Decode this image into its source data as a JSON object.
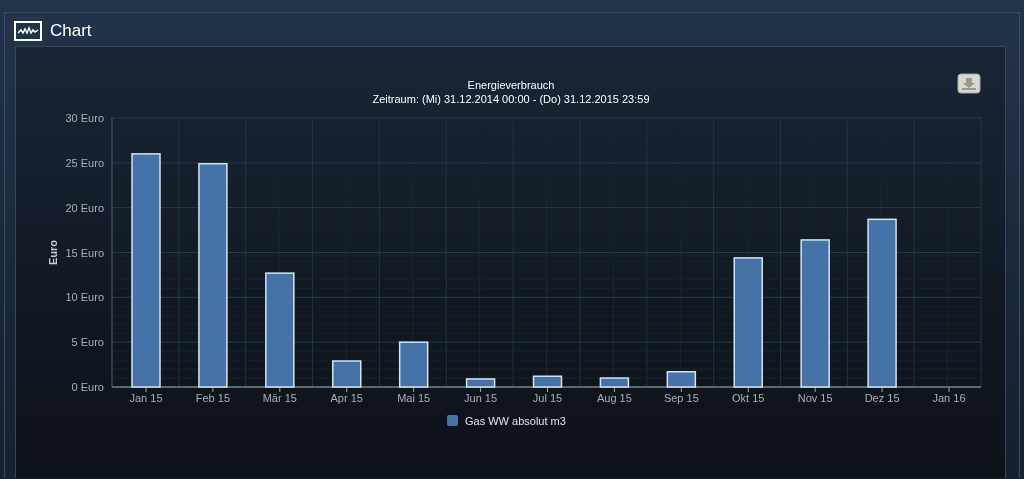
{
  "panel": {
    "title": "Chart"
  },
  "chart_data": {
    "type": "bar",
    "title": "Energieverbrauch",
    "subtitle": "Zeitraum: (Mi) 31.12.2014 00:00 - (Do) 31.12.2015 23:59",
    "ylabel": "Euro",
    "categories": [
      "Jan 15",
      "Feb 15",
      "Mär 15",
      "Apr 15",
      "Mai 15",
      "Jun 15",
      "Jul 15",
      "Aug 15",
      "Sep 15",
      "Okt 15",
      "Nov 15",
      "Dez 15",
      "Jan 16"
    ],
    "series": [
      {
        "name": "Gas WW absolut m3",
        "color": "#4572a7",
        "values": [
          26.0,
          24.9,
          12.7,
          2.9,
          5.0,
          0.9,
          1.2,
          1.0,
          1.7,
          14.4,
          16.4,
          18.7,
          null
        ]
      }
    ],
    "ylim": [
      0,
      30
    ],
    "grid": true,
    "yticks": [
      {
        "value": 0,
        "label": "0 Euro"
      },
      {
        "value": 5,
        "label": "5 Euro"
      },
      {
        "value": 10,
        "label": "10 Euro"
      },
      {
        "value": 15,
        "label": "15 Euro"
      },
      {
        "value": 20,
        "label": "20 Euro"
      },
      {
        "value": 25,
        "label": "25 Euro"
      },
      {
        "value": 30,
        "label": "30 Euro"
      }
    ]
  }
}
